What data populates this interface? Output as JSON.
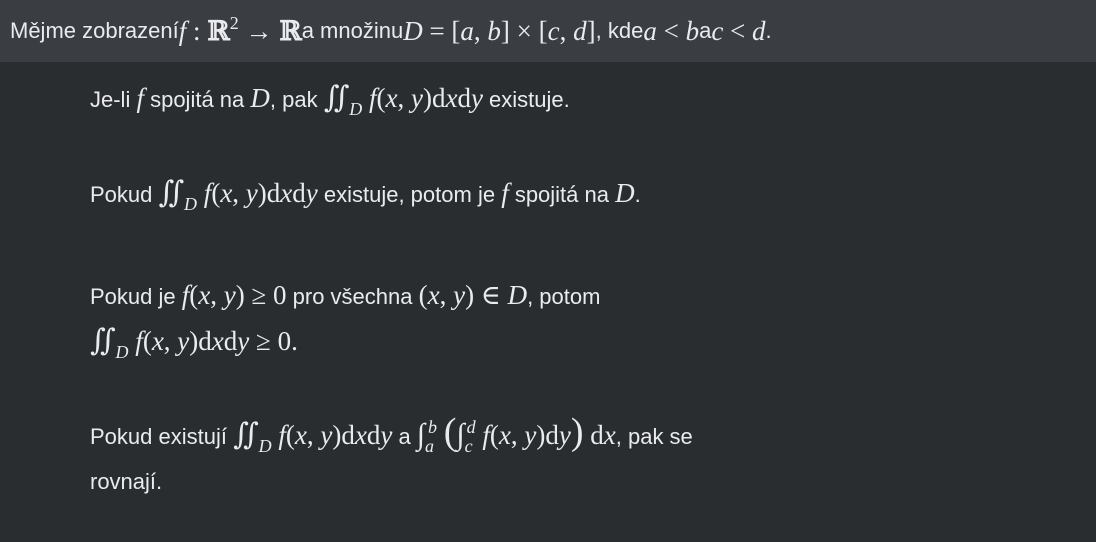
{
  "header": {
    "t1": "Mějme zobrazení ",
    "m1": "f : ℝ² → ℝ",
    "t2": " a množinu ",
    "m2": "D = [a, b] × [c, d]",
    "t3": ", kde ",
    "m3": "a < b",
    "t4": " a ",
    "m4": "c < d",
    "t5": "."
  },
  "options": [
    {
      "t1": "Je-li ",
      "m1": "f",
      "t2": " spojitá na ",
      "m2": "D",
      "t3": ", pak ",
      "m3": "∬_D f(x, y)dxdy",
      "t4": " existuje."
    },
    {
      "t1": "Pokud ",
      "m1": "∬_D f(x, y)dxdy",
      "t2": " existuje, potom je ",
      "m2": "f",
      "t3": " spojitá na ",
      "m3": "D",
      "t4": "."
    },
    {
      "t1": "Pokud je ",
      "m1": "f(x, y) ≥ 0",
      "t2": " pro všechna ",
      "m2": "(x, y) ∈ D",
      "t3": ", potom",
      "m4": "∬_D f(x, y)dxdy ≥ 0."
    },
    {
      "t1": "Pokud existují ",
      "m1": "∬_D f(x, y)dxdy",
      "t2": " a ",
      "m2": "∫_a^b ( ∫_c^d f(x, y)dy ) dx",
      "t3": ", pak se",
      "t4": "rovnají."
    }
  ]
}
